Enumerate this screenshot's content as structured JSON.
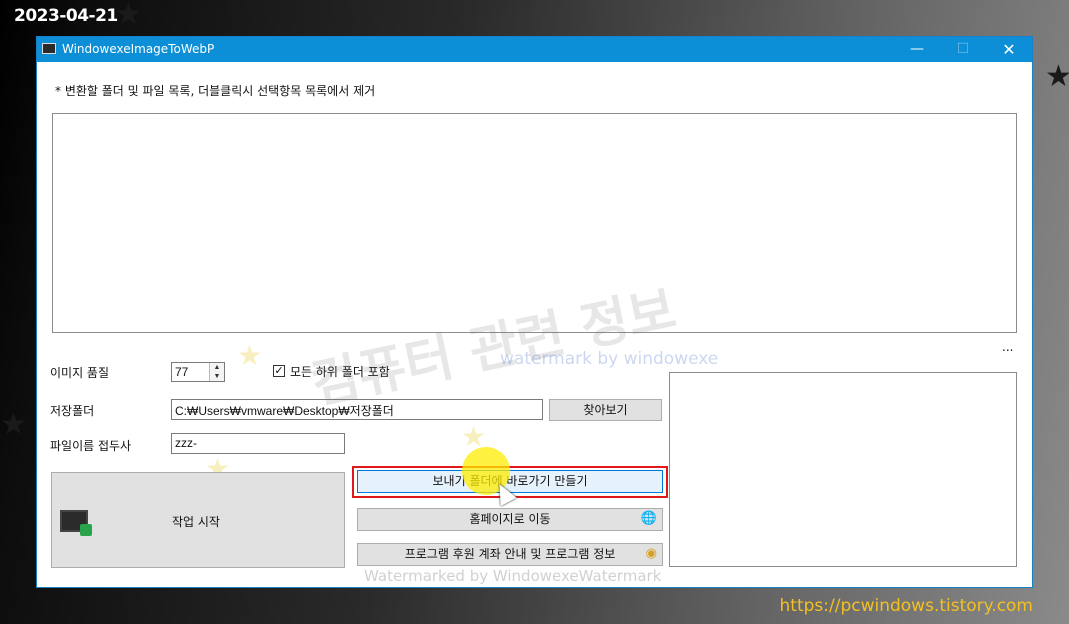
{
  "overlay": {
    "date": "2023-04-21",
    "site_url": "https://pcwindows.tistory.com"
  },
  "window": {
    "title": "WindowexeImageToWebP",
    "icon": "image-icon",
    "controls": {
      "minimize": "—",
      "maximize": "☐",
      "close": "✕"
    },
    "accent_color": "#0d8fd8"
  },
  "main": {
    "instruction": "* 변환할 폴더 및 파일 목록, 더블클릭시 선택항목 목록에서 제거",
    "quality_label": "이미지 품질",
    "quality_value": "77",
    "include_subfolders_label": "모든 하위 폴더 포함",
    "include_subfolders_checked": true,
    "save_folder_label": "저장폴더",
    "save_folder_value": "C:₩Users₩vmware₩Desktop₩저장폴더",
    "browse_button": "찾아보기",
    "filename_prefix_label": "파일이름 접두사",
    "filename_prefix_value": "zzz-",
    "start_button": "작업 시작",
    "sendto_shortcut_button": "보내기 폴더에 바로가기 만들기",
    "homepage_button": "홈페이지로 이동",
    "donation_button": "프로그램 후원 계좌 안내 및 프로그램 정보",
    "ellipsis": "..."
  },
  "watermarks": {
    "big": "컴퓨터 관련 정보",
    "small": "watermark by windowexe",
    "bottom": "Watermarked by WindowexeWatermark"
  },
  "icons": {
    "homepage": "globe-icon",
    "donation": "coins-icon",
    "start": "image-convert-icon"
  }
}
